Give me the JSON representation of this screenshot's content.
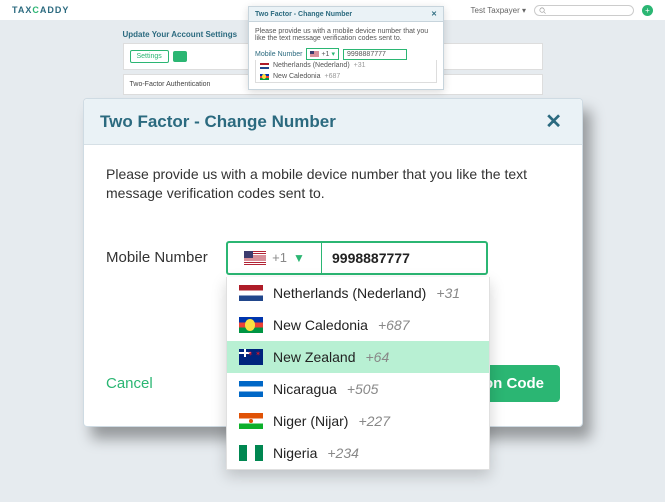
{
  "brand": {
    "pre": "TAX",
    "c": "C",
    "post": "ADDY"
  },
  "user_menu": "Test Taxpayer",
  "bg": {
    "section_title": "Update Your Account Settings",
    "settings_chip": "Settings",
    "twofa_label": "Two-Factor Authentication"
  },
  "small_modal": {
    "title": "Two Factor - Change Number",
    "desc": "Please provide us with a mobile device number that you like the text message verification codes sent to.",
    "mobile_label": "Mobile Number",
    "code": "+1",
    "phone": "9998887777",
    "opts": [
      {
        "name": "Netherlands (Nederland)",
        "code": "+31",
        "flag": "flag-nl"
      },
      {
        "name": "New Caledonia",
        "code": "+687",
        "flag": "flag-nc"
      }
    ]
  },
  "modal": {
    "title": "Two Factor - Change Number",
    "description": "Please provide us with a mobile device number that you like the text message verification codes sent to.",
    "mobile_label": "Mobile Number",
    "cc_code": "+1",
    "phone": "9998887777",
    "cancel": "Cancel",
    "primary": "Send Verification Code",
    "primary_visible": "ion Code"
  },
  "countries": [
    {
      "name": "Netherlands (Nederland)",
      "code": "+31",
      "flag": "flag-nl",
      "hl": false
    },
    {
      "name": "New Caledonia",
      "code": "+687",
      "flag": "flag-nc",
      "hl": false
    },
    {
      "name": "New Zealand",
      "code": "+64",
      "flag": "flag-nz",
      "hl": true
    },
    {
      "name": "Nicaragua",
      "code": "+505",
      "flag": "flag-ni",
      "hl": false
    },
    {
      "name": "Niger (Nijar)",
      "code": "+227",
      "flag": "flag-ne",
      "hl": false
    },
    {
      "name": "Nigeria",
      "code": "+234",
      "flag": "flag-ng",
      "hl": false
    }
  ]
}
